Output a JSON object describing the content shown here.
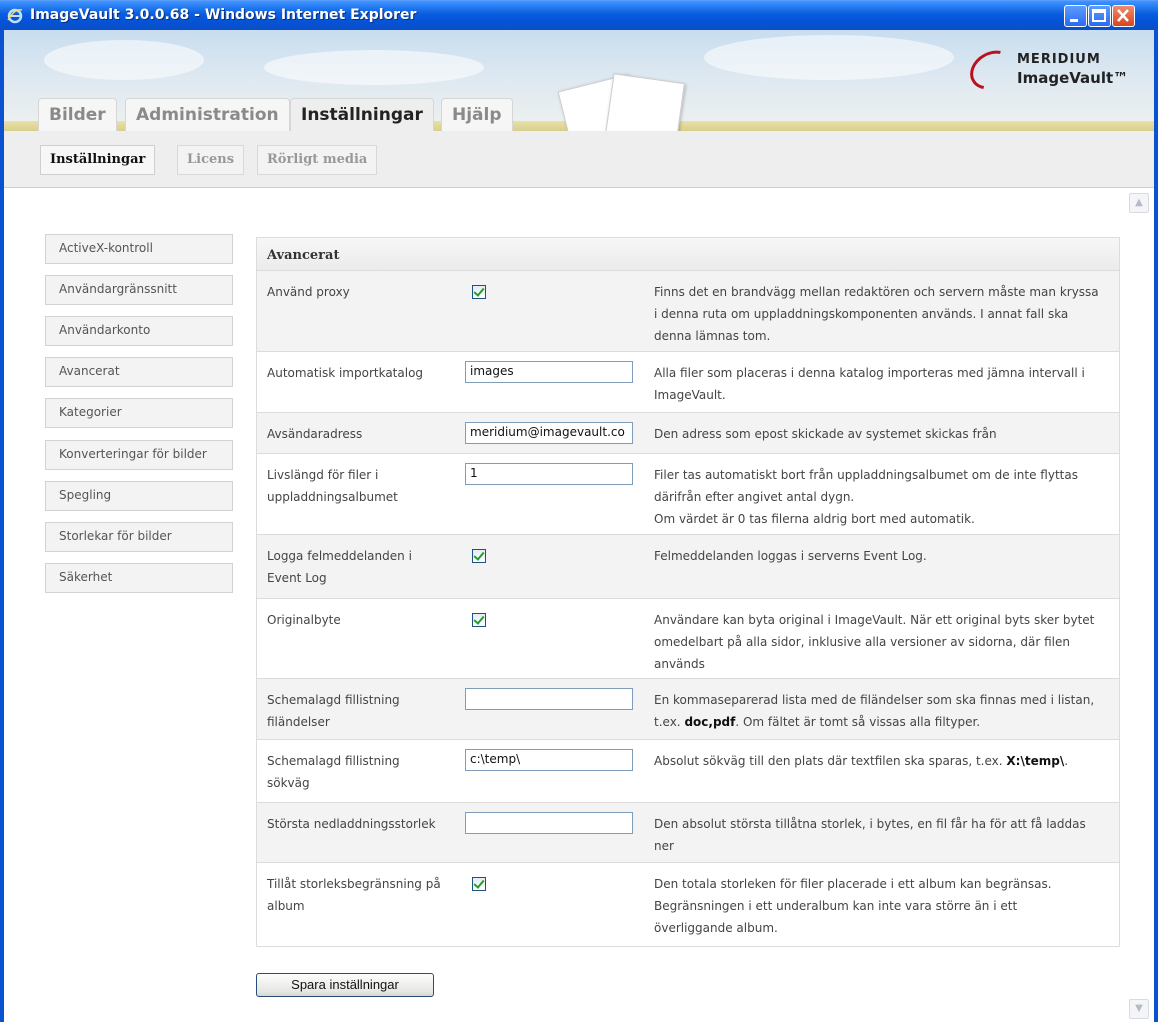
{
  "window": {
    "title": "ImageVault 3.0.0.68 - Windows Internet Explorer",
    "icon": "ie-icon"
  },
  "logo": {
    "top": "MERIDIUM",
    "bottom": "ImageVault™"
  },
  "main_tabs": [
    {
      "label": "Bilder",
      "active": false
    },
    {
      "label": "Administration",
      "active": false
    },
    {
      "label": "Inställningar",
      "active": true
    },
    {
      "label": "Hjälp",
      "active": false
    }
  ],
  "sub_tabs": [
    {
      "label": "Inställningar",
      "active": true
    },
    {
      "label": "Licens",
      "active": false
    },
    {
      "label": "Rörligt media",
      "active": false
    }
  ],
  "left_nav": [
    "ActiveX-kontroll",
    "Användargränssnitt",
    "Användarkonto",
    "Avancerat",
    "Kategorier",
    "Konverteringar för bilder",
    "Spegling",
    "Storlekar för bilder",
    "Säkerhet"
  ],
  "panel": {
    "title": "Avancerat",
    "rows": [
      {
        "label": "Använd proxy",
        "control": "checkbox",
        "checked": true,
        "description": "Finns det en brandvägg mellan redaktören och servern måste man kryssa i denna ruta om uppladdningskomponenten används. I annat fall ska denna lämnas tom."
      },
      {
        "label": "Automatisk importkatalog",
        "control": "text",
        "value": "images",
        "description": "Alla filer som placeras i denna katalog importeras med jämna intervall i ImageVault."
      },
      {
        "label": "Avsändaradress",
        "control": "text",
        "value": "meridium@imagevault.co",
        "description": "Den adress som epost skickade av systemet skickas från"
      },
      {
        "label": "Livslängd för filer i uppladdningsalbumet",
        "control": "text",
        "value": "1",
        "description": "Filer tas automatiskt bort från uppladdningsalbumet om de inte flyttas därifrån efter angivet antal dygn.",
        "description2": "Om värdet är 0 tas filerna aldrig bort med automatik."
      },
      {
        "label": "Logga felmeddelanden i Event Log",
        "control": "checkbox",
        "checked": true,
        "description": "Felmeddelanden loggas i serverns Event Log."
      },
      {
        "label": "Originalbyte",
        "control": "checkbox",
        "checked": true,
        "description": "Användare kan byta original i ImageVault. När ett original byts sker bytet omedelbart på alla sidor, inklusive alla versioner av sidorna, där filen används"
      },
      {
        "label": "Schemalagd fillistning filändelser",
        "control": "text",
        "value": "",
        "description_pre": "En kommaseparerad lista med de filändelser som ska finnas med i listan, t.ex.",
        "description_bold": "doc,pdf",
        "description_post": ". Om fältet är tomt så vissas alla filtyper."
      },
      {
        "label": "Schemalagd fillistning sökväg",
        "control": "text",
        "value": "c:\\temp\\",
        "description_pre": "Absolut sökväg till den plats där textfilen ska sparas, t.ex.",
        "description_bold": "X:\\temp\\",
        "description_post": "."
      },
      {
        "label": "Största nedladdningsstorlek",
        "control": "text",
        "value": "",
        "description": "Den absolut största tillåtna storlek, i bytes, en fil får ha för att få laddas ner"
      },
      {
        "label": "Tillåt storleksbegränsning på album",
        "control": "checkbox",
        "checked": true,
        "description": "Den totala storleken för filer placerade i ett album kan begränsas. Begränsningen i ett underalbum kan inte vara större än i ett överliggande album."
      }
    ]
  },
  "save_button": "Spara inställningar"
}
